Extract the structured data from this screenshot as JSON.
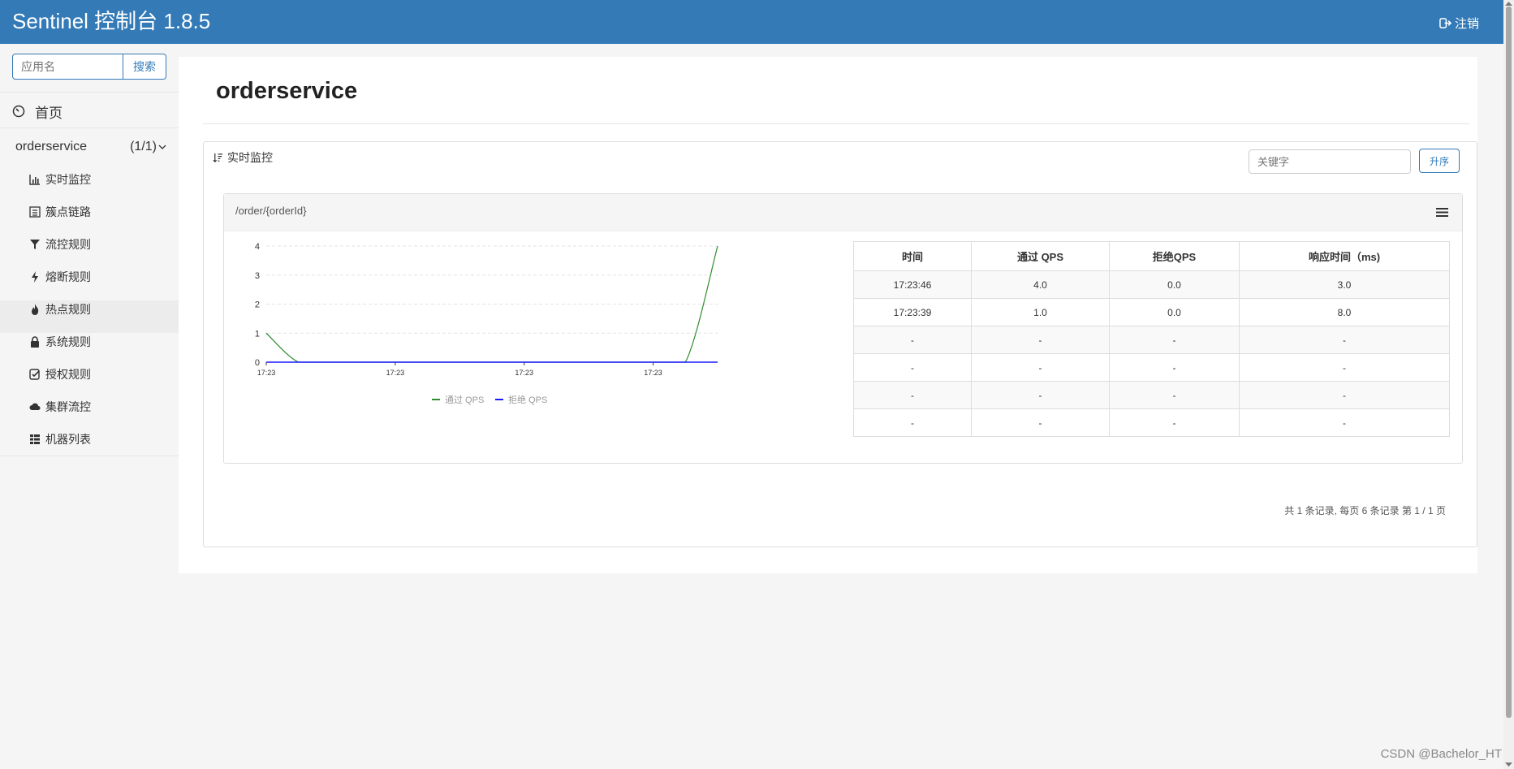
{
  "header": {
    "title": "Sentinel 控制台 1.8.5",
    "logout_label": "注销"
  },
  "sidebar": {
    "search_placeholder": "应用名",
    "search_button": "搜索",
    "home_label": "首页",
    "app": {
      "name": "orderservice",
      "count": "(1/1)"
    },
    "menu_items": [
      {
        "label": "实时监控",
        "icon": "bar-chart-icon"
      },
      {
        "label": "簇点链路",
        "icon": "list-icon"
      },
      {
        "label": "流控规则",
        "icon": "filter-icon"
      },
      {
        "label": "熔断规则",
        "icon": "flash-icon"
      },
      {
        "label": "热点规则",
        "icon": "fire-icon"
      },
      {
        "label": "系统规则",
        "icon": "lock-icon"
      },
      {
        "label": "授权规则",
        "icon": "check-icon"
      },
      {
        "label": "集群流控",
        "icon": "cloud-icon"
      },
      {
        "label": "机器列表",
        "icon": "grid-icon"
      }
    ]
  },
  "main": {
    "page_title": "orderservice",
    "section_title": "实时监控",
    "keyword_placeholder": "关键字",
    "sort_button": "升序",
    "resource_title": "/order/{orderId}",
    "table": {
      "headers": [
        "时间",
        "通过 QPS",
        "拒绝QPS",
        "响应时间（ms)"
      ],
      "rows": [
        [
          "17:23:46",
          "4.0",
          "0.0",
          "3.0"
        ],
        [
          "17:23:39",
          "1.0",
          "0.0",
          "8.0"
        ],
        [
          "-",
          "-",
          "-",
          "-"
        ],
        [
          "-",
          "-",
          "-",
          "-"
        ],
        [
          "-",
          "-",
          "-",
          "-"
        ],
        [
          "-",
          "-",
          "-",
          "-"
        ]
      ]
    },
    "pager": "共 1 条记录, 每页 6 条记录 第 1 / 1 页"
  },
  "chart_data": {
    "type": "line",
    "x": [
      0,
      1,
      2,
      3,
      4,
      5,
      6,
      7,
      8,
      9,
      10,
      11,
      12,
      13,
      14
    ],
    "x_ticks": [
      "17:23",
      "17:23",
      "17:23",
      "17:23"
    ],
    "y_ticks": [
      "0",
      "1",
      "2",
      "3",
      "4"
    ],
    "ylim": [
      0,
      4
    ],
    "grid": true,
    "legend_position": "bottom",
    "series": [
      {
        "name": "通过 QPS",
        "color": "#2e8b2e",
        "values": [
          1,
          0,
          0,
          0,
          0,
          0,
          0,
          0,
          0,
          0,
          0,
          0,
          0,
          0,
          4
        ]
      },
      {
        "name": "拒绝 QPS",
        "color": "#1a1aff",
        "values": [
          0,
          0,
          0,
          0,
          0,
          0,
          0,
          0,
          0,
          0,
          0,
          0,
          0,
          0,
          0
        ]
      }
    ]
  },
  "watermark": "CSDN @Bachelor_HT"
}
